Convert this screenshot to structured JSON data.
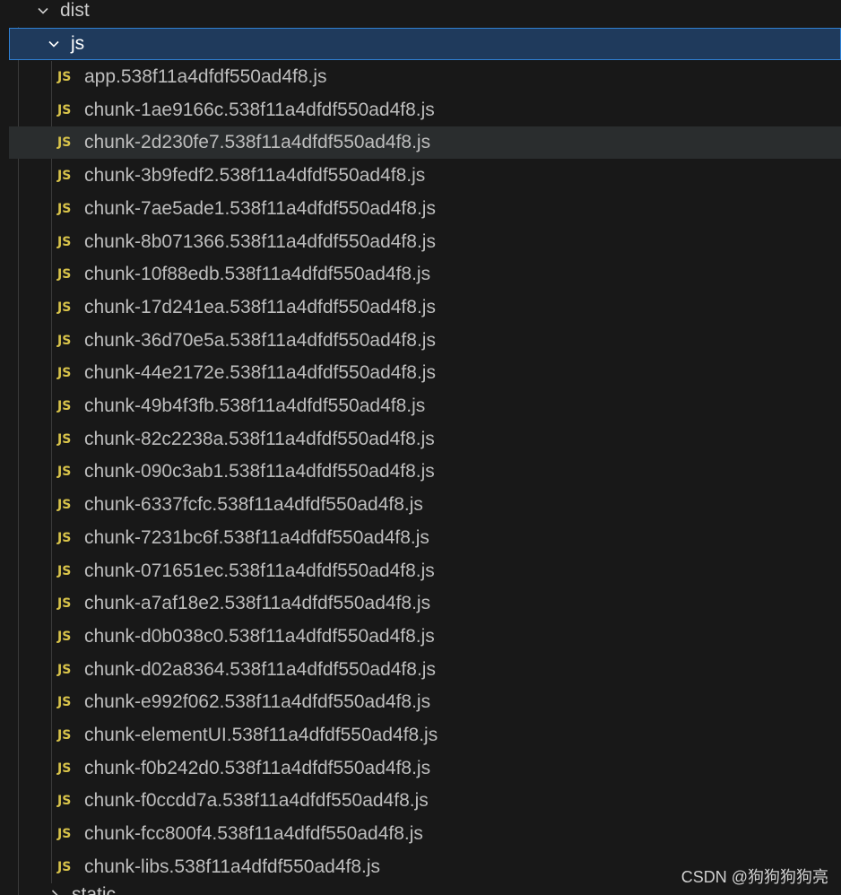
{
  "explorer": {
    "dist_folder": {
      "label": "dist",
      "expanded": true
    },
    "js_folder": {
      "label": "js",
      "expanded": true,
      "selected": true
    },
    "file_icon_text": "JS",
    "files": [
      "app.538f11a4dfdf550ad4f8.js",
      "chunk-1ae9166c.538f11a4dfdf550ad4f8.js",
      "chunk-2d230fe7.538f11a4dfdf550ad4f8.js",
      "chunk-3b9fedf2.538f11a4dfdf550ad4f8.js",
      "chunk-7ae5ade1.538f11a4dfdf550ad4f8.js",
      "chunk-8b071366.538f11a4dfdf550ad4f8.js",
      "chunk-10f88edb.538f11a4dfdf550ad4f8.js",
      "chunk-17d241ea.538f11a4dfdf550ad4f8.js",
      "chunk-36d70e5a.538f11a4dfdf550ad4f8.js",
      "chunk-44e2172e.538f11a4dfdf550ad4f8.js",
      "chunk-49b4f3fb.538f11a4dfdf550ad4f8.js",
      "chunk-82c2238a.538f11a4dfdf550ad4f8.js",
      "chunk-090c3ab1.538f11a4dfdf550ad4f8.js",
      "chunk-6337fcfc.538f11a4dfdf550ad4f8.js",
      "chunk-7231bc6f.538f11a4dfdf550ad4f8.js",
      "chunk-071651ec.538f11a4dfdf550ad4f8.js",
      "chunk-a7af18e2.538f11a4dfdf550ad4f8.js",
      "chunk-d0b038c0.538f11a4dfdf550ad4f8.js",
      "chunk-d02a8364.538f11a4dfdf550ad4f8.js",
      "chunk-e992f062.538f11a4dfdf550ad4f8.js",
      "chunk-elementUI.538f11a4dfdf550ad4f8.js",
      "chunk-f0b242d0.538f11a4dfdf550ad4f8.js",
      "chunk-f0ccdd7a.538f11a4dfdf550ad4f8.js",
      "chunk-fcc800f4.538f11a4dfdf550ad4f8.js",
      "chunk-libs.538f11a4dfdf550ad4f8.js"
    ],
    "hovered_file": "chunk-2d230fe7.538f11a4dfdf550ad4f8.js",
    "next_folder_partial": {
      "label": "static",
      "expanded": false
    }
  },
  "watermark": "CSDN @狗狗狗狗亮",
  "colors": {
    "background": "#181818",
    "selection_bg": "#1f3a5c",
    "selection_border": "#2f7fd1",
    "hover_bg": "#2a2d2e",
    "js_icon": "#d8c34a"
  }
}
